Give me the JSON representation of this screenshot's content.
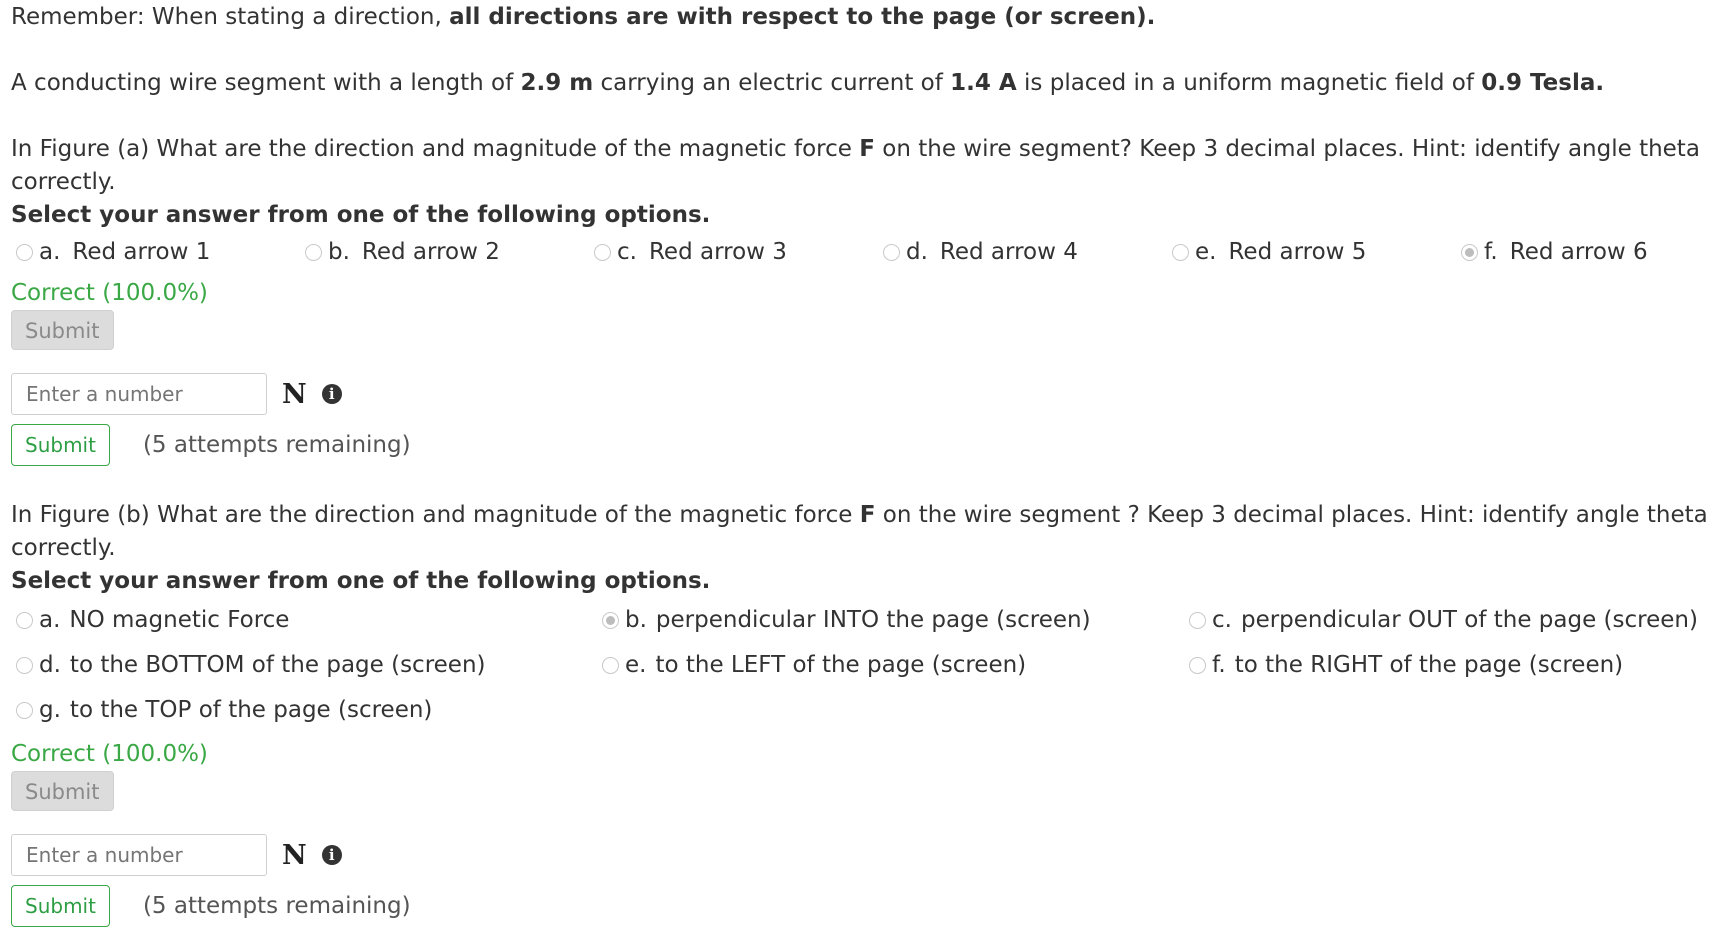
{
  "remember": {
    "prefix": "Remember: When stating a direction,",
    "bold": "all directions are with respect to the page (or screen)."
  },
  "intro": {
    "t1": "A conducting wire segment with a length of",
    "length": "2.9 m",
    "t2": "carrying an electric current  of",
    "current": "1.4 A",
    "t3": "is placed in a uniform magnetic field of",
    "field": "0.9 Tesla."
  },
  "q1": {
    "text_pre": "In Figure (a) What are the direction and magnitude of the magnetic force",
    "force_symbol": "F",
    "text_post": "on the wire segment? Keep 3 decimal places.   Hint: identify angle theta correctly.",
    "select_heading": "Select your answer from one of the following options.",
    "options": [
      {
        "letter": "a.",
        "label": "Red arrow 1",
        "checked": false
      },
      {
        "letter": "b.",
        "label": "Red arrow 2",
        "checked": false
      },
      {
        "letter": "c.",
        "label": "Red arrow 3",
        "checked": false
      },
      {
        "letter": "d.",
        "label": "Red arrow 4",
        "checked": false
      },
      {
        "letter": "e.",
        "label": "Red arrow 5",
        "checked": false
      },
      {
        "letter": "f.",
        "label": "Red arrow 6",
        "checked": true
      }
    ],
    "result": "Correct (100.0%)",
    "submit_disabled_label": "Submit",
    "number_placeholder": "Enter a number",
    "unit": "N",
    "submit_label": "Submit",
    "attempts": "(5 attempts remaining)"
  },
  "q2": {
    "text_pre": "In Figure (b) What are the direction and magnitude of the magnetic force",
    "force_symbol": "F",
    "text_post": "on the wire segment ? Keep 3 decimal places.  Hint: identify angle theta correctly.",
    "select_heading": "Select your answer from one of the following options.",
    "options": [
      {
        "letter": "a.",
        "label": "NO magnetic Force",
        "checked": false
      },
      {
        "letter": "b.",
        "label": "perpendicular INTO the page (screen)",
        "checked": true
      },
      {
        "letter": "c.",
        "label": "perpendicular OUT of the page (screen)",
        "checked": false
      },
      {
        "letter": "d.",
        "label": "to the BOTTOM of the page (screen)",
        "checked": false
      },
      {
        "letter": "e.",
        "label": "to the LEFT of the page (screen)",
        "checked": false
      },
      {
        "letter": "f.",
        "label": "to the RIGHT of the page (screen)",
        "checked": false
      },
      {
        "letter": "g.",
        "label": "to the TOP of the page (screen)",
        "checked": false
      }
    ],
    "result": "Correct (100.0%)",
    "submit_disabled_label": "Submit",
    "number_placeholder": "Enter a number",
    "unit": "N",
    "submit_label": "Submit",
    "attempts": "(5 attempts remaining)"
  },
  "icons": {
    "info": "info-circle-icon"
  },
  "colors": {
    "correct": "#3aa845",
    "text": "#333333",
    "button_disabled_bg": "#dcdcdc"
  }
}
